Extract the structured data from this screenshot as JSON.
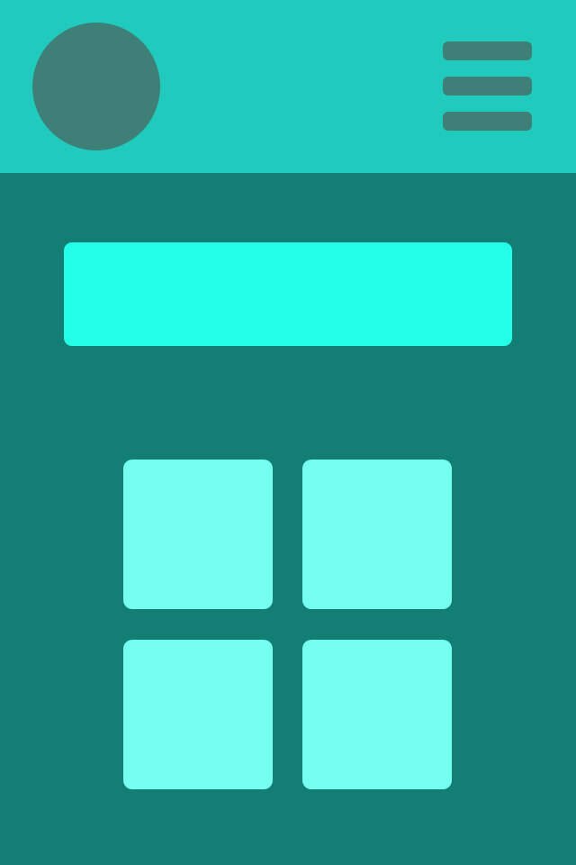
{
  "header": {
    "avatar_icon": "avatar",
    "menu_icon": "hamburger-menu-icon"
  },
  "main": {
    "banner": {},
    "tiles": [
      {},
      {},
      {},
      {}
    ]
  },
  "colors": {
    "background": "#127e74",
    "header": "#20cbbd",
    "avatar": "#3e7f78",
    "menu_icon": "#3e7f78",
    "banner": "#24ffe8",
    "tile": "#74fff0"
  }
}
